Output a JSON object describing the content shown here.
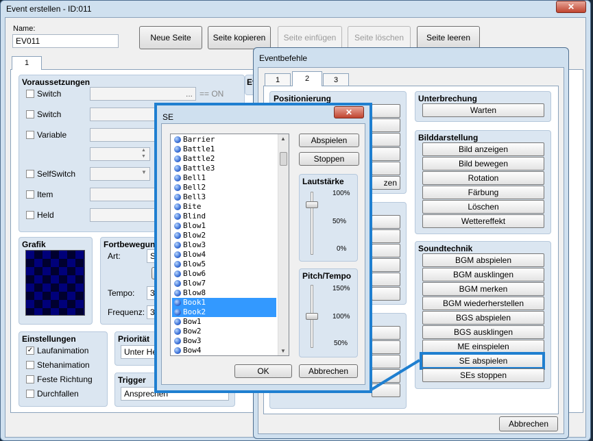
{
  "main_window": {
    "title": "Event erstellen - ID:011",
    "name_label": "Name:",
    "name_value": "EV011",
    "buttons": {
      "new_page": "Neue Seite",
      "copy_page": "Seite kopieren",
      "paste_page": "Seite einfügen",
      "delete_page": "Seite löschen",
      "clear_page": "Seite leeren"
    },
    "page_tab": "1",
    "conditions": {
      "heading": "Voraussetzungen",
      "switch1": "Switch",
      "switch1_value": "...",
      "equals_on": "== ON",
      "switch2": "Switch",
      "variable": "Variable",
      "selfswitch": "SelfSwitch",
      "item": "Item",
      "actor": "Held"
    },
    "graphic": {
      "heading": "Grafik"
    },
    "movement": {
      "heading": "Fortbewegun",
      "type_label": "Art:",
      "type_value": "S",
      "speed_label": "Tempo:",
      "speed_value": "3",
      "freq_label": "Frequenz:",
      "freq_value": "3"
    },
    "options": {
      "heading": "Einstellungen",
      "walk_anim": "Laufanimation",
      "step_anim": "Stehanimation",
      "dir_fix": "Feste Richtung",
      "through": "Durchfallen",
      "walk_anim_checked": true
    },
    "priority": {
      "heading": "Priorität",
      "value": "Unter He"
    },
    "trigger": {
      "heading": "Trigger",
      "value": "Ansprechen"
    },
    "partial_heading": "Ev"
  },
  "command_window": {
    "title": "Eventbefehle",
    "tabs": [
      "1",
      "2",
      "3"
    ],
    "active_tab": "2",
    "positioning": {
      "heading": "Positionierung",
      "partial_btn": "zen"
    },
    "interrupt": {
      "heading": "Unterbrechung",
      "buttons": [
        "Warten"
      ]
    },
    "picture": {
      "heading": "Bilddarstellung",
      "buttons": [
        "Bild anzeigen",
        "Bild bewegen",
        "Rotation",
        "Färbung",
        "Löschen",
        "Wettereffekt"
      ]
    },
    "sound": {
      "heading": "Soundtechnik",
      "buttons": [
        "BGM abspielen",
        "BGM ausklingen",
        "BGM merken",
        "BGM wiederherstellen",
        "BGS abspielen",
        "BGS ausklingen",
        "ME einspielen",
        "SE abspielen",
        "SEs stoppen"
      ]
    },
    "cancel": "Abbrechen",
    "highlight_color": "#1f7fd0"
  },
  "se_dialog": {
    "title": "SE",
    "items": [
      "Barrier",
      "Battle1",
      "Battle2",
      "Battle3",
      "Bell1",
      "Bell2",
      "Bell3",
      "Bite",
      "Blind",
      "Blow1",
      "Blow2",
      "Blow3",
      "Blow4",
      "Blow5",
      "Blow6",
      "Blow7",
      "Blow8",
      "Book1",
      "Book2",
      "Bow1",
      "Bow2",
      "Bow3",
      "Bow4"
    ],
    "selected": [
      "Book1",
      "Book2"
    ],
    "play": "Abspielen",
    "stop": "Stoppen",
    "volume": {
      "heading": "Lautstärke",
      "ticks": [
        "100%",
        "50%",
        "0%"
      ],
      "value_percent": 100
    },
    "pitch": {
      "heading": "Pitch/Tempo",
      "ticks": [
        "150%",
        "100%",
        "50%"
      ],
      "value_percent": 100
    },
    "ok": "OK",
    "cancel": "Abbrechen"
  }
}
